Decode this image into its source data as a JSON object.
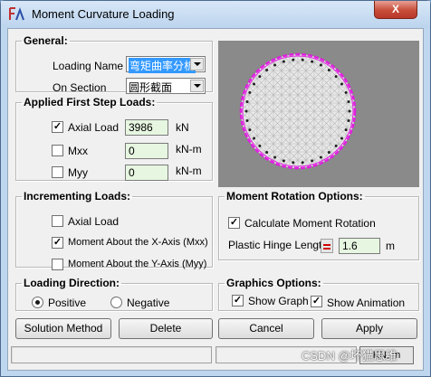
{
  "window": {
    "title": "Moment Curvature Loading",
    "close_label": "X"
  },
  "general": {
    "legend": "General:",
    "loading_name_label": "Loading Name",
    "loading_name_value": "弯矩曲率分析",
    "on_section_label": "On Section",
    "on_section_value": "圆形截面"
  },
  "first_step": {
    "legend": "Applied First Step Loads:",
    "rows": [
      {
        "label": "Axial Load",
        "checked": true,
        "value": "3986",
        "unit": "kN"
      },
      {
        "label": "Mxx",
        "checked": false,
        "value": "0",
        "unit": "kN-m"
      },
      {
        "label": "Myy",
        "checked": false,
        "value": "0",
        "unit": "kN-m"
      }
    ]
  },
  "incrementing": {
    "legend": "Incrementing Loads:",
    "options": [
      {
        "label": "Axial Load",
        "checked": false
      },
      {
        "label": "Moment About the X-Axis (Mxx)",
        "checked": true
      },
      {
        "label": "Moment About the Y-Axis (Myy)",
        "checked": false
      }
    ]
  },
  "loading_direction": {
    "legend": "Loading Direction:",
    "positive_label": "Positive",
    "negative_label": "Negative",
    "selected": "Positive"
  },
  "moment_rotation": {
    "legend": "Moment Rotation Options:",
    "calc_label": "Calculate Moment Rotation",
    "calc_checked": true,
    "hinge_label": "Plastic Hinge Length",
    "hinge_value": "1.6",
    "hinge_unit": "m"
  },
  "graphics": {
    "legend": "Graphics Options:",
    "show_graph_label": "Show Graph",
    "show_graph_checked": true,
    "show_animation_label": "Show Animation",
    "show_animation_checked": true
  },
  "buttons": {
    "solution_method": "Solution Method",
    "delete": "Delete",
    "cancel": "Cancel",
    "apply": "Apply"
  },
  "statusbar": {
    "units_label": "KN, m"
  },
  "watermark": "CSDN @坏猫思维",
  "colors": {
    "section_outline": "#e020e0",
    "section_fill": "#e8e8e8",
    "rebar": "#202020",
    "preview_bg": "#8a8a8a"
  }
}
